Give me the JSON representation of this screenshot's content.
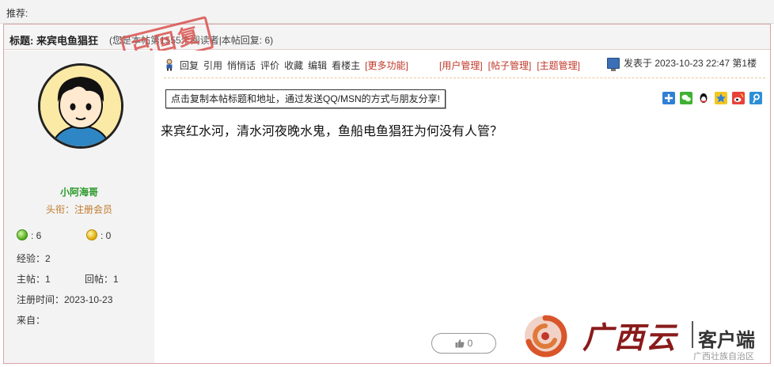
{
  "topbar": {
    "label": "推荐:"
  },
  "title": {
    "label": "标题: 来宾电鱼猖狂",
    "meta": "(您是本帖第1555个阅读者|本帖回复: 6)",
    "stamp": "已回复"
  },
  "author": {
    "username": "小阿海哥",
    "rank": "头衔：注册会员",
    "green_count": "6",
    "yellow_count": "0",
    "exp": "经验：2",
    "topics": "主帖：1",
    "replies": "回帖：1",
    "registered": "注册时间：2023-10-23",
    "from": "来自："
  },
  "toolbar": {
    "items": [
      "回复",
      "引用",
      "悄悄话",
      "评价",
      "收藏",
      "编辑",
      "看楼主"
    ],
    "more": "[更多功能]"
  },
  "management": [
    "[用户管理]",
    "[帖子管理]",
    "[主题管理]"
  ],
  "posted": {
    "text": "发表于 2023-10-23 22:47 第1楼"
  },
  "share": {
    "label": "点击复制本帖标题和地址，通过发送QQ/MSN的方式与朋友分享!"
  },
  "post": {
    "body": "来宾红水河，清水河夜晚水鬼，鱼船电鱼猖狂为何没有人管？"
  },
  "like": {
    "count": "0"
  },
  "brand": {
    "name": "广西云",
    "client": "客户端",
    "sub": "广西壮族自治区"
  },
  "colors": {
    "accent_red": "#c0392b",
    "username_green": "#2a9a2a",
    "rank_orange": "#c07a2a"
  }
}
